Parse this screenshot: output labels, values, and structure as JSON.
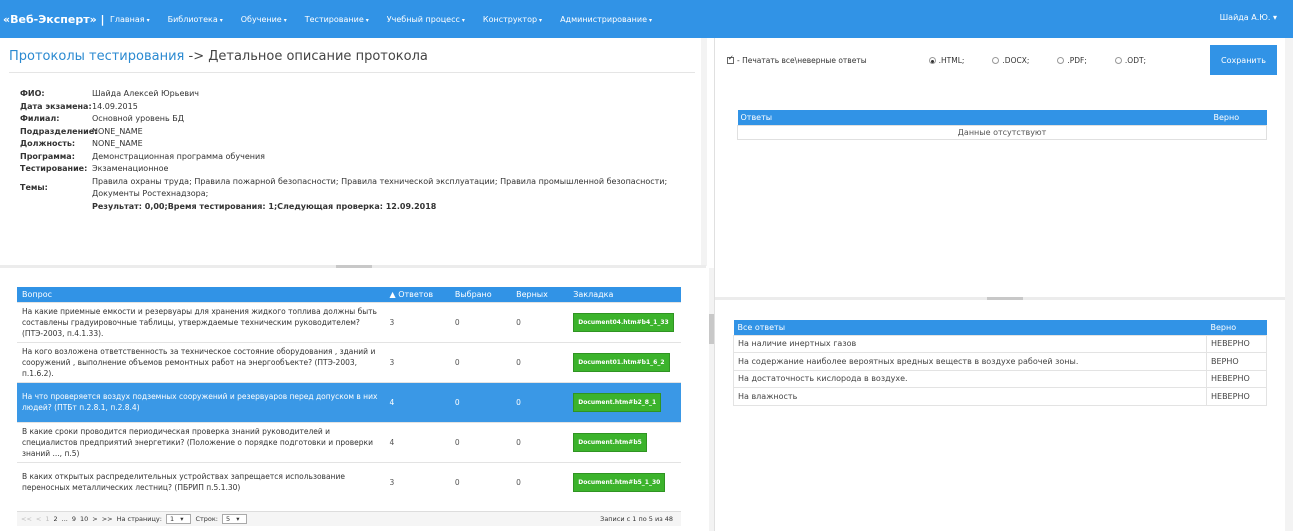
{
  "nav": {
    "brand": "«Веб-Эксперт» |",
    "items": [
      "Главная",
      "Библиотека",
      "Обучение",
      "Тестирование",
      "Учебный процесс",
      "Конструктор",
      "Администрирование"
    ],
    "user": "Шайда А.Ю."
  },
  "page": {
    "title_link": "Протоколы тестирования",
    "title_rest": " -> Детальное описание протокола"
  },
  "info": {
    "fio_label": "ФИО:",
    "fio": "Шайда Алексей Юрьевич",
    "date_label": "Дата экзамена:",
    "date": "14.09.2015",
    "branch_label": "Филиал:",
    "branch": "Основной уровень БД",
    "division_label": "Подразделение:",
    "division": "NONE_NAME",
    "position_label": "Должность:",
    "position": "NONE_NAME",
    "program_label": "Программа:",
    "program": "Демонстрационная программа обучения",
    "testing_label": "Тестирование:",
    "testing": "Экзаменационное",
    "topics_label": "Темы:",
    "topics_line1": "Правила охраны труда; Правила пожарной безопасности; Правила технической эксплуатации; Правила промышленной безопасности;",
    "topics_line2": "Документы Ростехнадзора;",
    "result_label": "Результат:",
    "result": "0,00;",
    "time_label": "Время тестирования:",
    "time": "1;",
    "next_label": "Следующая проверка:",
    "next": "12.09.2018"
  },
  "questions": {
    "headers": [
      "Вопрос",
      "Ответов",
      "Выбрано",
      "Верных",
      "Закладка"
    ],
    "sort_icon": "▲",
    "rows": [
      {
        "q": "На какие приемные емкости и резервуары для хранения жидкого топлива должны быть составлены градуировочные таблицы, утверждаемые техническим руководителем? (ПТЭ-2003, п.4.1.33).",
        "answers": "3",
        "chosen": "0",
        "correct": "0",
        "bookmark": "Document04.htm#b4_1_33"
      },
      {
        "q": "На кого возложена ответственность за техническое состояние оборудования , зданий и сооружений , выполнение объемов ремонтных работ на энергообъекте? (ПТЭ-2003, п.1.6.2).",
        "answers": "3",
        "chosen": "0",
        "correct": "0",
        "bookmark": "Document01.htm#b1_6_2"
      },
      {
        "q": "На что проверяется воздух подземных сооружений и резервуаров перед допуском в них людей? (ПТБт п.2.8.1, п.2.8.4)",
        "answers": "4",
        "chosen": "0",
        "correct": "0",
        "bookmark": "Document.htm#b2_8_1"
      },
      {
        "q": "В какие сроки проводится периодическая проверка знаний руководителей и специалистов предприятий энергетики? (Положение о порядке подготовки и проверки знаний ..., п.5)",
        "answers": "4",
        "chosen": "0",
        "correct": "0",
        "bookmark": "Document.htm#b5"
      },
      {
        "q": "В каких открытых распределительных устройствах запрещается использование переносных металлических лестниц? (ПБРИП п.5.1.30)",
        "answers": "3",
        "chosen": "0",
        "correct": "0",
        "bookmark": "Document.htm#b5_1_30"
      }
    ],
    "selected_index": 2
  },
  "pager": {
    "first": "<<",
    "prev": "<",
    "p1": "1",
    "p2": "2",
    "dots": "...",
    "p9": "9",
    "p10": "10",
    "next": ">",
    "last": ">>",
    "per_page_label": "На страницу:",
    "per_page": "1",
    "rows_label": "Строк:",
    "rows": "5",
    "records": "Записи с 1 по 5 из 48"
  },
  "options": {
    "print_label": "- Печатать все\\неверные ответы",
    "formats": [
      ".HTML;",
      ".DOCX;",
      ".PDF;",
      ".ODT;"
    ],
    "selected_format": 0,
    "save": "Сохранить"
  },
  "answers": {
    "headers": [
      "Ответы",
      "Верно"
    ],
    "empty": "Данные отсутствуют"
  },
  "all_answers": {
    "headers": [
      "Все ответы",
      "Верно"
    ],
    "rows": [
      {
        "text": "На наличие инертных газов",
        "verdict": "НЕВЕРНО"
      },
      {
        "text": "На содержание наиболее вероятных вредных веществ в воздухе рабочей зоны.",
        "verdict": "ВЕРНО"
      },
      {
        "text": "На достаточность кислорода в воздухе.",
        "verdict": "НЕВЕРНО"
      },
      {
        "text": "На влажность",
        "verdict": "НЕВЕРНО"
      }
    ]
  },
  "colors": {
    "accent": "#3193e6",
    "bookmark": "#3cb32c"
  }
}
